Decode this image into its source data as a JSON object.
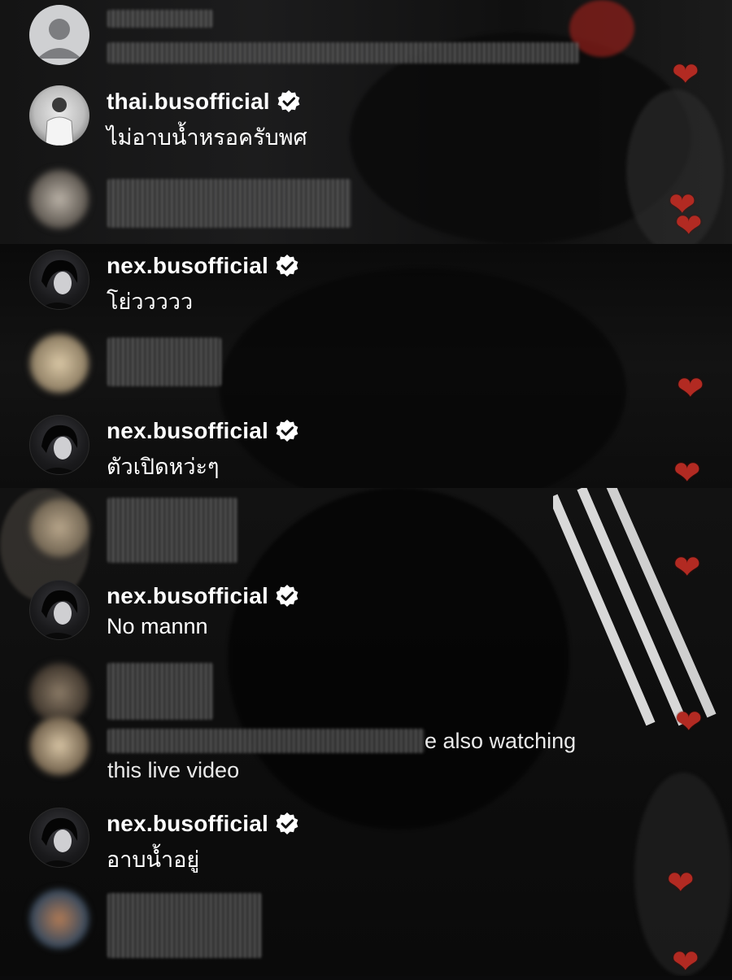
{
  "comments": [
    {
      "username": "thai.busofficial",
      "text": "ไม่อาบน้ำหรอครับพศ",
      "verified": true
    },
    {
      "username": "nex.busofficial",
      "text": "โย่ววววว",
      "verified": true
    },
    {
      "username": "nex.busofficial",
      "text": "ตัวเปิดหว่ะๆ",
      "verified": true
    },
    {
      "username": "nex.busofficial",
      "text": "No mannn",
      "verified": true
    },
    {
      "username": "nex.busofficial",
      "text": "อาบน้ำอยู่",
      "verified": true
    }
  ],
  "system_notice": {
    "text_line1": "e also watching",
    "text_line2": "this live video"
  },
  "reaction_icon": "heart-icon",
  "colors": {
    "heart": "#b22a22",
    "badge": "#ffffff",
    "text": "#ffffff"
  }
}
